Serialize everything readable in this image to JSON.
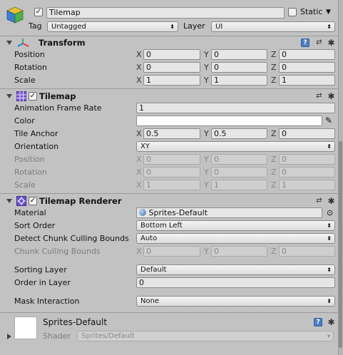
{
  "gameobject": {
    "name": "Tilemap",
    "active": true,
    "static_label": "Static",
    "tag_label": "Tag",
    "tag_value": "Untagged",
    "layer_label": "Layer",
    "layer_value": "UI"
  },
  "transform": {
    "title": "Transform",
    "rows": [
      {
        "label": "Position",
        "x": "0",
        "y": "0",
        "z": "0"
      },
      {
        "label": "Rotation",
        "x": "0",
        "y": "0",
        "z": "0"
      },
      {
        "label": "Scale",
        "x": "1",
        "y": "1",
        "z": "1"
      }
    ]
  },
  "axes": {
    "x": "X",
    "y": "Y",
    "z": "Z"
  },
  "tilemap": {
    "title": "Tilemap",
    "enabled": true,
    "anim_rate_label": "Animation Frame Rate",
    "anim_rate_value": "1",
    "color_label": "Color",
    "color_value": "#ffffff",
    "tile_anchor_label": "Tile Anchor",
    "tile_anchor": {
      "x": "0.5",
      "y": "0.5",
      "z": "0"
    },
    "orientation_label": "Orientation",
    "orientation_value": "XY",
    "disabled_rows": [
      {
        "label": "Position",
        "x": "0",
        "y": "0",
        "z": "0"
      },
      {
        "label": "Rotation",
        "x": "0",
        "y": "0",
        "z": "0"
      },
      {
        "label": "Scale",
        "x": "1",
        "y": "1",
        "z": "1"
      }
    ]
  },
  "renderer": {
    "title": "Tilemap Renderer",
    "enabled": true,
    "material_label": "Material",
    "material_value": "Sprites-Default",
    "sort_order_label": "Sort Order",
    "sort_order_value": "Bottom Left",
    "detect_label": "Detect Chunk Culling Bounds",
    "detect_value": "Auto",
    "chunk_label": "Chunk Culling Bounds",
    "chunk": {
      "x": "0",
      "y": "0",
      "z": "0"
    },
    "sorting_layer_label": "Sorting Layer",
    "sorting_layer_value": "Default",
    "order_label": "Order in Layer",
    "order_value": "0",
    "mask_label": "Mask Interaction",
    "mask_value": "None"
  },
  "material_preview": {
    "name": "Sprites-Default",
    "shader_label": "Shader",
    "shader_value": "Sprites/Default"
  },
  "icons": {
    "help": "?",
    "preset": "⇄",
    "gear": "✱",
    "check": "✓",
    "dropdown": "⬍",
    "static_arrow": "▼",
    "target": "⊙",
    "eyedropper": "✎"
  }
}
